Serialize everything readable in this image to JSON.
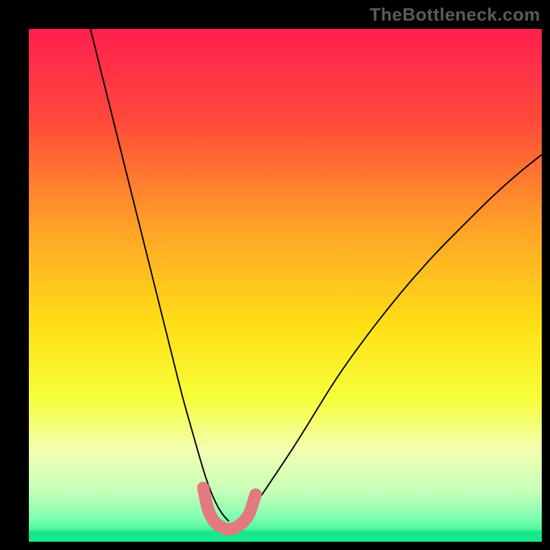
{
  "watermark": "TheBottleneck.com",
  "chart_data": {
    "type": "line",
    "title": "",
    "xlabel": "",
    "ylabel": "",
    "xlim": [
      0,
      100
    ],
    "ylim": [
      0,
      100
    ],
    "background_gradient_stops": [
      {
        "pos": 0.0,
        "color": "#ff1f4f"
      },
      {
        "pos": 0.18,
        "color": "#ff4a3a"
      },
      {
        "pos": 0.4,
        "color": "#ffa726"
      },
      {
        "pos": 0.58,
        "color": "#ffe015"
      },
      {
        "pos": 0.72,
        "color": "#f6ff3a"
      },
      {
        "pos": 0.82,
        "color": "#f2ffb0"
      },
      {
        "pos": 0.9,
        "color": "#c8ffb9"
      },
      {
        "pos": 0.955,
        "color": "#7effb0"
      },
      {
        "pos": 1.0,
        "color": "#17e98a"
      }
    ],
    "series": [
      {
        "name": "left-curve",
        "color": "#000000",
        "stroke_width": 2,
        "x": [
          12,
          14,
          16,
          18,
          20,
          22,
          24,
          26,
          28,
          30,
          32,
          34,
          35,
          36,
          37,
          38,
          39
        ],
        "y": [
          100,
          92,
          84,
          76,
          68,
          60,
          52,
          44,
          36,
          28,
          21,
          14,
          11,
          8.5,
          6.5,
          5,
          4
        ]
      },
      {
        "name": "right-curve",
        "color": "#000000",
        "stroke_width": 2,
        "x": [
          41,
          42,
          43,
          45,
          48,
          52,
          56,
          60,
          65,
          70,
          75,
          80,
          85,
          90,
          95,
          100
        ],
        "y": [
          4,
          5,
          6,
          8.5,
          13,
          19,
          25.5,
          32,
          39,
          45.5,
          51.5,
          57,
          62,
          67,
          71.5,
          75.5
        ]
      },
      {
        "name": "bottom-marker-band",
        "color": "#e27a7f",
        "stroke_width": 18,
        "linecap": "round",
        "x": [
          34.0,
          34.5,
          35.0,
          36.0,
          37.5,
          39.0,
          40.5,
          42.0,
          43.0,
          43.6,
          44.2
        ],
        "y": [
          10.5,
          8.0,
          6.0,
          4.0,
          2.8,
          2.3,
          2.8,
          4.0,
          5.4,
          7.2,
          9.2
        ]
      }
    ],
    "bottom_band": {
      "from_y": 0,
      "to_y": 2.2,
      "color": "#17e98a"
    }
  }
}
